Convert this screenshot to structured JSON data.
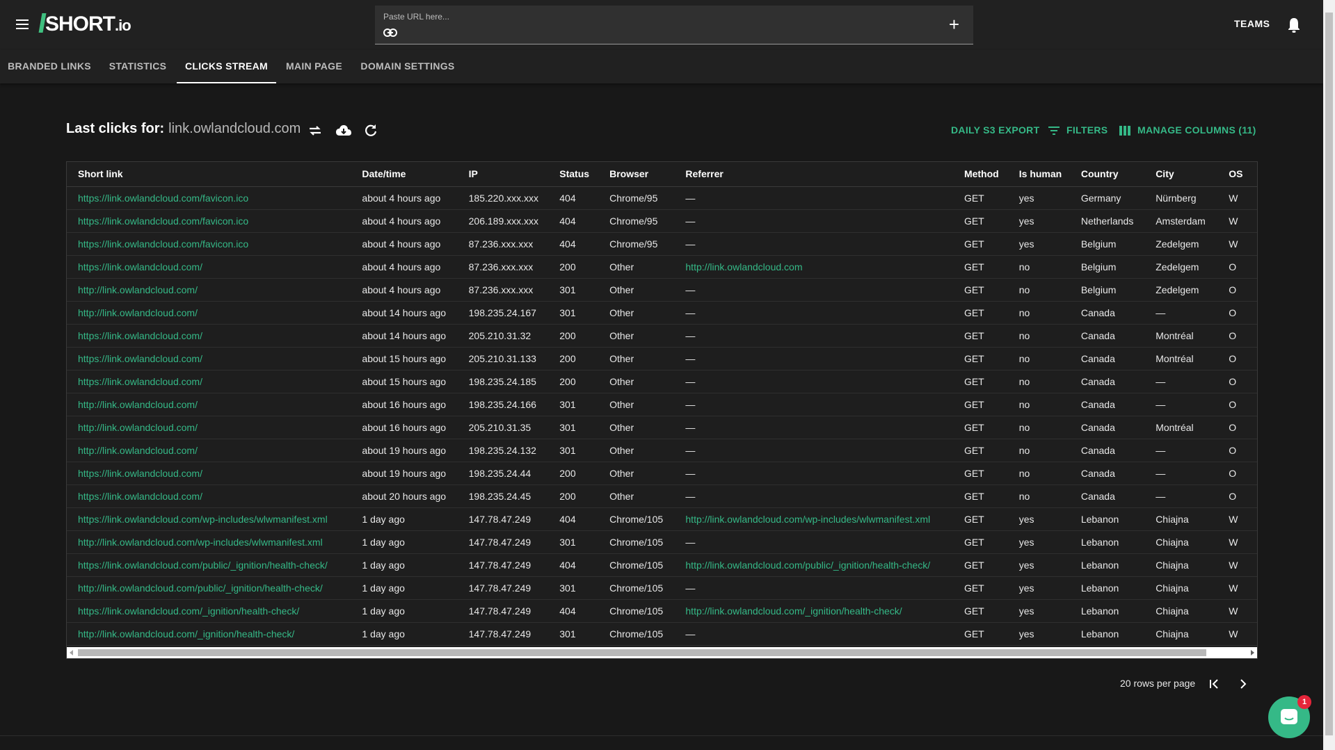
{
  "header": {
    "brand": "SHORT",
    "brand_suffix": ".io",
    "url_placeholder": "Paste URL here...",
    "teams_label": "TEAMS"
  },
  "tabs": [
    {
      "label": "BRANDED LINKS",
      "active": false
    },
    {
      "label": "STATISTICS",
      "active": false
    },
    {
      "label": "CLICKS STREAM",
      "active": true
    },
    {
      "label": "MAIN PAGE",
      "active": false
    },
    {
      "label": "DOMAIN SETTINGS",
      "active": false
    }
  ],
  "content": {
    "title_prefix": "Last clicks for:",
    "domain": "link.owlandcloud.com",
    "actions": {
      "daily_export": "DAILY S3 EXPORT",
      "filters": "FILTERS",
      "manage_columns": "MANAGE COLUMNS (11)"
    }
  },
  "table": {
    "columns": [
      "Short link",
      "Date/time",
      "IP",
      "Status",
      "Browser",
      "Referrer",
      "Method",
      "Is human",
      "Country",
      "City",
      "OS"
    ],
    "rows": [
      [
        "https://link.owlandcloud.com/favicon.ico",
        "about 4 hours ago",
        "185.220.xxx.xxx",
        "404",
        "Chrome/95",
        "—",
        "GET",
        "yes",
        "Germany",
        "Nürnberg",
        "W"
      ],
      [
        "https://link.owlandcloud.com/favicon.ico",
        "about 4 hours ago",
        "206.189.xxx.xxx",
        "404",
        "Chrome/95",
        "—",
        "GET",
        "yes",
        "Netherlands",
        "Amsterdam",
        "W"
      ],
      [
        "https://link.owlandcloud.com/favicon.ico",
        "about 4 hours ago",
        "87.236.xxx.xxx",
        "404",
        "Chrome/95",
        "—",
        "GET",
        "yes",
        "Belgium",
        "Zedelgem",
        "W"
      ],
      [
        "https://link.owlandcloud.com/",
        "about 4 hours ago",
        "87.236.xxx.xxx",
        "200",
        "Other",
        "http://link.owlandcloud.com",
        "GET",
        "no",
        "Belgium",
        "Zedelgem",
        "O"
      ],
      [
        "http://link.owlandcloud.com/",
        "about 4 hours ago",
        "87.236.xxx.xxx",
        "301",
        "Other",
        "—",
        "GET",
        "no",
        "Belgium",
        "Zedelgem",
        "O"
      ],
      [
        "http://link.owlandcloud.com/",
        "about 14 hours ago",
        "198.235.24.167",
        "301",
        "Other",
        "—",
        "GET",
        "no",
        "Canada",
        "—",
        "O"
      ],
      [
        "https://link.owlandcloud.com/",
        "about 14 hours ago",
        "205.210.31.32",
        "200",
        "Other",
        "—",
        "GET",
        "no",
        "Canada",
        "Montréal",
        "O"
      ],
      [
        "https://link.owlandcloud.com/",
        "about 15 hours ago",
        "205.210.31.133",
        "200",
        "Other",
        "—",
        "GET",
        "no",
        "Canada",
        "Montréal",
        "O"
      ],
      [
        "https://link.owlandcloud.com/",
        "about 15 hours ago",
        "198.235.24.185",
        "200",
        "Other",
        "—",
        "GET",
        "no",
        "Canada",
        "—",
        "O"
      ],
      [
        "http://link.owlandcloud.com/",
        "about 16 hours ago",
        "198.235.24.166",
        "301",
        "Other",
        "—",
        "GET",
        "no",
        "Canada",
        "—",
        "O"
      ],
      [
        "http://link.owlandcloud.com/",
        "about 16 hours ago",
        "205.210.31.35",
        "301",
        "Other",
        "—",
        "GET",
        "no",
        "Canada",
        "Montréal",
        "O"
      ],
      [
        "http://link.owlandcloud.com/",
        "about 19 hours ago",
        "198.235.24.132",
        "301",
        "Other",
        "—",
        "GET",
        "no",
        "Canada",
        "—",
        "O"
      ],
      [
        "https://link.owlandcloud.com/",
        "about 19 hours ago",
        "198.235.24.44",
        "200",
        "Other",
        "—",
        "GET",
        "no",
        "Canada",
        "—",
        "O"
      ],
      [
        "https://link.owlandcloud.com/",
        "about 20 hours ago",
        "198.235.24.45",
        "200",
        "Other",
        "—",
        "GET",
        "no",
        "Canada",
        "—",
        "O"
      ],
      [
        "https://link.owlandcloud.com/wp-includes/wlwmanifest.xml",
        "1 day ago",
        "147.78.47.249",
        "404",
        "Chrome/105",
        "http://link.owlandcloud.com/wp-includes/wlwmanifest.xml",
        "GET",
        "yes",
        "Lebanon",
        "Chiajna",
        "W"
      ],
      [
        "http://link.owlandcloud.com/wp-includes/wlwmanifest.xml",
        "1 day ago",
        "147.78.47.249",
        "301",
        "Chrome/105",
        "—",
        "GET",
        "yes",
        "Lebanon",
        "Chiajna",
        "W"
      ],
      [
        "https://link.owlandcloud.com/public/_ignition/health-check/",
        "1 day ago",
        "147.78.47.249",
        "404",
        "Chrome/105",
        "http://link.owlandcloud.com/public/_ignition/health-check/",
        "GET",
        "yes",
        "Lebanon",
        "Chiajna",
        "W"
      ],
      [
        "http://link.owlandcloud.com/public/_ignition/health-check/",
        "1 day ago",
        "147.78.47.249",
        "301",
        "Chrome/105",
        "—",
        "GET",
        "yes",
        "Lebanon",
        "Chiajna",
        "W"
      ],
      [
        "https://link.owlandcloud.com/_ignition/health-check/",
        "1 day ago",
        "147.78.47.249",
        "404",
        "Chrome/105",
        "http://link.owlandcloud.com/_ignition/health-check/",
        "GET",
        "yes",
        "Lebanon",
        "Chiajna",
        "W"
      ],
      [
        "http://link.owlandcloud.com/_ignition/health-check/",
        "1 day ago",
        "147.78.47.249",
        "301",
        "Chrome/105",
        "—",
        "GET",
        "yes",
        "Lebanon",
        "Chiajna",
        "W"
      ]
    ]
  },
  "pagination": {
    "rows_per_page": "20 rows per page"
  },
  "chat": {
    "badge_count": "1"
  },
  "colors": {
    "accent": "#35b987",
    "background": "#181818",
    "header": "#212121"
  }
}
